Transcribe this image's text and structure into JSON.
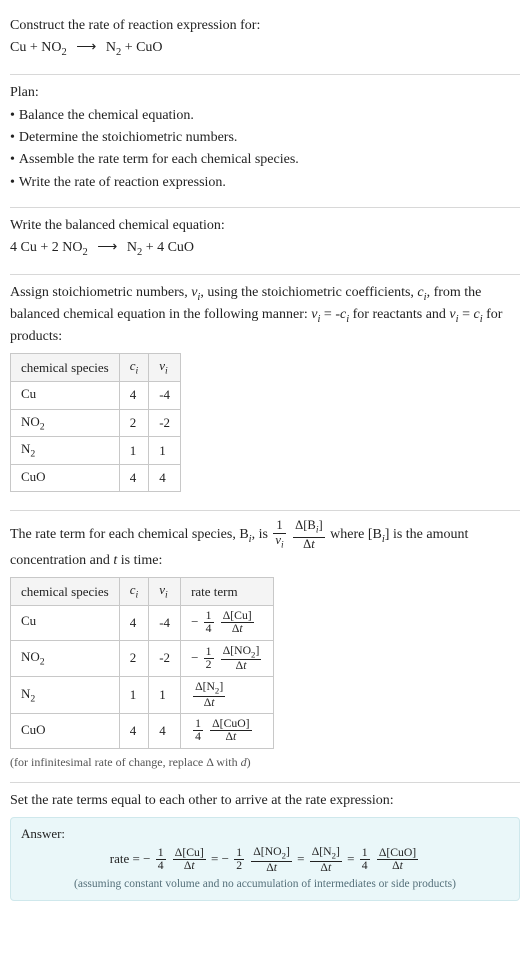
{
  "header": {
    "prompt": "Construct the rate of reaction expression for:",
    "unbalanced": {
      "lhs1": "Cu",
      "lhs2_a": "NO",
      "lhs2_sub": "2",
      "rhs1_a": "N",
      "rhs1_sub": "2",
      "rhs2": "CuO",
      "arrow": "⟶",
      "plus": " + "
    }
  },
  "plan": {
    "title": "Plan:",
    "items": [
      "Balance the chemical equation.",
      "Determine the stoichiometric numbers.",
      "Assemble the rate term for each chemical species.",
      "Write the rate of reaction expression."
    ],
    "bullet": "•"
  },
  "balanced": {
    "title": "Write the balanced chemical equation:",
    "c1": "4 ",
    "s1": "Cu",
    "plus1": " + ",
    "c2": "2 ",
    "s2a": "NO",
    "s2sub": "2",
    "arrow": "⟶",
    "c3a": "N",
    "c3sub": "2",
    "plus2": " + ",
    "c4": "4 ",
    "s4": "CuO"
  },
  "stoich": {
    "intro_pre": "Assign stoichiometric numbers, ",
    "nu_i": "ν",
    "nu_sub": "i",
    "intro_mid": ", using the stoichiometric coefficients, ",
    "c_i": "c",
    "c_sub": "i",
    "intro_post1": ", from the balanced chemical equation in the following manner: ",
    "eq1_lhs_a": "ν",
    "eq1_lhs_sub": "i",
    "eq1_eq": " = -",
    "eq1_rhs_a": "c",
    "eq1_rhs_sub": "i",
    "intro_post2": " for reactants and ",
    "eq2_lhs_a": "ν",
    "eq2_lhs_sub": "i",
    "eq2_eq": " = ",
    "eq2_rhs_a": "c",
    "eq2_rhs_sub": "i",
    "intro_post3": " for products:",
    "headers": {
      "col1": "chemical species",
      "col2_a": "c",
      "col2_sub": "i",
      "col3_a": "ν",
      "col3_sub": "i"
    },
    "rows": [
      {
        "species_a": "Cu",
        "species_sub": "",
        "c": "4",
        "nu": "-4"
      },
      {
        "species_a": "NO",
        "species_sub": "2",
        "c": "2",
        "nu": "-2"
      },
      {
        "species_a": "N",
        "species_sub": "2",
        "c": "1",
        "nu": "1"
      },
      {
        "species_a": "CuO",
        "species_sub": "",
        "c": "4",
        "nu": "4"
      }
    ]
  },
  "rateterm": {
    "intro_pre": "The rate term for each chemical species, B",
    "intro_sub1": "i",
    "intro_mid1": ", is ",
    "frac1_num": "1",
    "frac1_den_a": "ν",
    "frac1_den_sub": "i",
    "frac2_num_a": "Δ[B",
    "frac2_num_sub": "i",
    "frac2_num_b": "]",
    "frac2_den_a": "Δ",
    "frac2_den_b": "t",
    "intro_mid2": " where [B",
    "intro_sub2": "i",
    "intro_mid3": "] is the amount concentration and ",
    "t_ital": "t",
    "intro_post": " is time:",
    "headers": {
      "col1": "chemical species",
      "col2_a": "c",
      "col2_sub": "i",
      "col3_a": "ν",
      "col3_sub": "i",
      "col4": "rate term"
    },
    "rows": [
      {
        "species_a": "Cu",
        "species_sub": "",
        "c": "4",
        "nu": "-4",
        "sign": "−",
        "coef_num": "1",
        "coef_den": "4",
        "d_num_a": "Δ[Cu]",
        "d_den_a": "Δ",
        "d_den_b": "t"
      },
      {
        "species_a": "NO",
        "species_sub": "2",
        "c": "2",
        "nu": "-2",
        "sign": "−",
        "coef_num": "1",
        "coef_den": "2",
        "d_num_a": "Δ[NO",
        "d_num_sub": "2",
        "d_num_b": "]",
        "d_den_a": "Δ",
        "d_den_b": "t"
      },
      {
        "species_a": "N",
        "species_sub": "2",
        "c": "1",
        "nu": "1",
        "sign": "",
        "coef_num": "",
        "coef_den": "",
        "d_num_a": "Δ[N",
        "d_num_sub": "2",
        "d_num_b": "]",
        "d_den_a": "Δ",
        "d_den_b": "t"
      },
      {
        "species_a": "CuO",
        "species_sub": "",
        "c": "4",
        "nu": "4",
        "sign": "",
        "coef_num": "1",
        "coef_den": "4",
        "d_num_a": "Δ[CuO]",
        "d_den_a": "Δ",
        "d_den_b": "t"
      }
    ],
    "caption_pre": "(for infinitesimal rate of change, replace Δ with ",
    "caption_ital": "d",
    "caption_post": ")"
  },
  "setequal": {
    "text": "Set the rate terms equal to each other to arrive at the rate expression:"
  },
  "answer": {
    "label": "Answer:",
    "rate_word": "rate",
    "eq": " = ",
    "terms": [
      {
        "sign": "−",
        "coef_num": "1",
        "coef_den": "4",
        "d_num": "Δ[Cu]",
        "d_den_a": "Δ",
        "d_den_b": "t"
      },
      {
        "sign": "−",
        "coef_num": "1",
        "coef_den": "2",
        "d_num_a": "Δ[NO",
        "d_num_sub": "2",
        "d_num_b": "]",
        "d_den_a": "Δ",
        "d_den_b": "t"
      },
      {
        "sign": "",
        "coef_num": "",
        "coef_den": "",
        "d_num_a": "Δ[N",
        "d_num_sub": "2",
        "d_num_b": "]",
        "d_den_a": "Δ",
        "d_den_b": "t"
      },
      {
        "sign": "",
        "coef_num": "1",
        "coef_den": "4",
        "d_num": "Δ[CuO]",
        "d_den_a": "Δ",
        "d_den_b": "t"
      }
    ],
    "note": "(assuming constant volume and no accumulation of intermediates or side products)"
  }
}
